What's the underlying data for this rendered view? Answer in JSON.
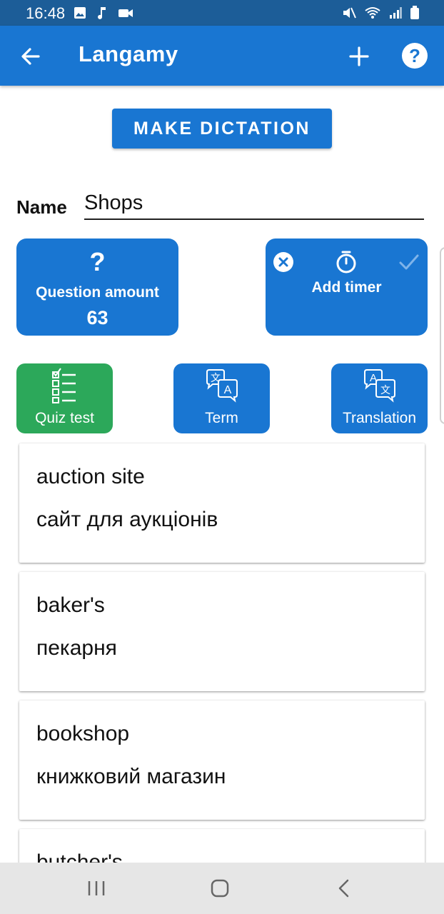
{
  "status_bar": {
    "time": "16:48",
    "left_icons": [
      "image-icon",
      "music-note-icon",
      "video-camera-icon"
    ],
    "right_icons": [
      "mute-icon",
      "wifi-icon",
      "signal-icon",
      "battery-icon"
    ]
  },
  "app_bar": {
    "title": "Langamy",
    "icons": [
      "arrow-back-icon",
      "plus-icon",
      "help-icon"
    ]
  },
  "make_dictation_label": "MAKE DICTATION",
  "name_field": {
    "label": "Name",
    "value": "Shops"
  },
  "question_tile": {
    "icon": "?",
    "label": "Question amount",
    "value": "63"
  },
  "timer_tile": {
    "label": "Add timer",
    "icons": [
      "close-circle-icon",
      "stopwatch-icon",
      "check-icon"
    ]
  },
  "modes": [
    {
      "label": "Quiz test",
      "icon": "checklist-icon",
      "selected": true
    },
    {
      "label": "Term",
      "icon": "translate-icon",
      "selected": false
    },
    {
      "label": "Translation",
      "icon": "translate-icon",
      "selected": false
    }
  ],
  "cards": [
    {
      "term": "auction site",
      "translation": "сайт для аукціонів"
    },
    {
      "term": "baker's",
      "translation": "пекарня"
    },
    {
      "term": "bookshop",
      "translation": "книжковий магазин"
    },
    {
      "term": "butcher's",
      "translation": ""
    }
  ],
  "colors": {
    "primary": "#1976d2",
    "status_bar": "#1c5d98",
    "quiz_green": "#2ca85a",
    "nav_bar": "#e6e6e6"
  },
  "nav_bar": {
    "icons": [
      "recent-apps-icon",
      "home-icon",
      "back-icon"
    ]
  }
}
